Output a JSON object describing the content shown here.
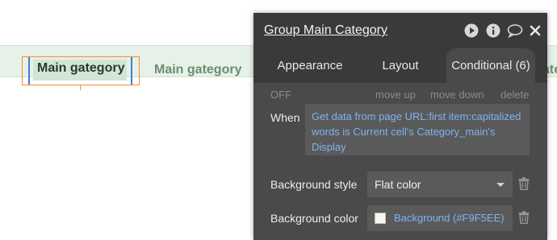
{
  "canvas": {
    "categories": [
      "Main gategory",
      "Main gategory",
      "ate"
    ]
  },
  "panel": {
    "title": "Group Main Category",
    "icons": [
      "play-icon",
      "info-icon",
      "comment-icon",
      "close-icon"
    ],
    "tabs": [
      "Appearance",
      "Layout",
      "Conditional (6)"
    ],
    "active_tab": "Conditional (6)",
    "toolbar": {
      "off": "OFF",
      "move_up": "move up",
      "move_down": "move down",
      "delete": "delete"
    },
    "when_label": "When",
    "condition": "Get data from page URL:first item:capitalized words is Current cell's Category_main's Display",
    "background_style": {
      "label": "Background style",
      "value": "Flat color"
    },
    "background_color": {
      "label": "Background color",
      "value": "Background (#F9F5EE)",
      "swatch": "#F9F5EE"
    }
  },
  "colors": {
    "accent_link": "#7fb3ee",
    "panel_bg": "#4a4a4a",
    "strip_bg": "#e6f1e7",
    "selection_orange": "#f08c3a",
    "selection_blue": "#3e7fd8"
  }
}
